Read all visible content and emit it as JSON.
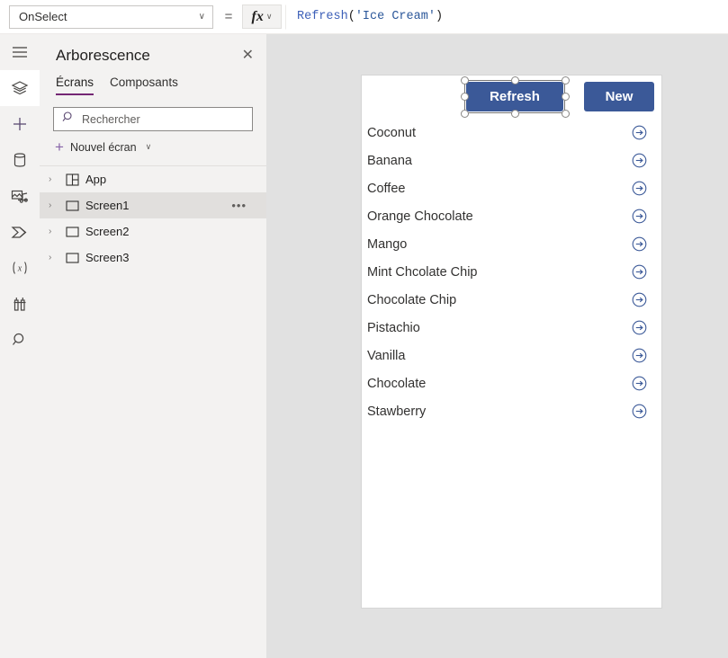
{
  "formula_bar": {
    "property": "OnSelect",
    "equals": "=",
    "fx_label": "fx",
    "chevron": "∨",
    "formula": {
      "function": "Refresh",
      "open_paren": "(",
      "string": "'Ice Cream'",
      "close_paren": ")"
    }
  },
  "rail": {
    "items": [
      {
        "name": "hamburger-menu-icon",
        "title": "Menu"
      },
      {
        "name": "tree-view-icon",
        "title": "Arborescence",
        "selected": true
      },
      {
        "name": "insert-plus-icon",
        "title": "Insérer"
      },
      {
        "name": "data-cylinder-icon",
        "title": "Données"
      },
      {
        "name": "media-icon",
        "title": "Médias"
      },
      {
        "name": "power-automate-icon",
        "title": "Power Automate"
      },
      {
        "name": "variables-icon",
        "title": "Variables"
      },
      {
        "name": "tools-icon",
        "title": "Outils"
      },
      {
        "name": "search-icon",
        "title": "Rechercher"
      }
    ]
  },
  "panel": {
    "title": "Arborescence",
    "close_label": "✕",
    "tabs": [
      {
        "label": "Écrans",
        "active": true
      },
      {
        "label": "Composants",
        "active": false
      }
    ],
    "search_placeholder": "Rechercher",
    "new_screen_label": "Nouvel écran",
    "new_screen_plus": "+",
    "new_screen_chevron": "∨",
    "tree": [
      {
        "label": "App",
        "icon": "app-grid-icon",
        "selected": false,
        "has_menu": false
      },
      {
        "label": "Screen1",
        "icon": "screen-rect-icon",
        "selected": true,
        "has_menu": true
      },
      {
        "label": "Screen2",
        "icon": "screen-rect-icon",
        "selected": false,
        "has_menu": false
      },
      {
        "label": "Screen3",
        "icon": "screen-rect-icon",
        "selected": false,
        "has_menu": false
      }
    ],
    "twisty": "›",
    "ellipsis": "•••"
  },
  "canvas": {
    "buttons": [
      {
        "label": "Refresh",
        "name": "refresh-button",
        "selected": true
      },
      {
        "label": "New",
        "name": "new-button",
        "selected": false
      }
    ],
    "gallery": {
      "items": [
        "Coconut",
        "Banana",
        "Coffee",
        "Orange Chocolate",
        "Mango",
        "Mint Chcolate Chip",
        "Chocolate Chip",
        "Pistachio",
        "Vanilla",
        "Chocolate",
        "Stawberry"
      ],
      "arrow_icon": "circled-right-arrow-icon"
    }
  },
  "colors": {
    "button_blue": "#3b5998",
    "accent_purple": "#742774",
    "panel_bg": "#f3f2f1",
    "workspace_bg": "#e1e1e1",
    "formula_function": "#3c5fb8",
    "formula_string": "#2b579a"
  }
}
